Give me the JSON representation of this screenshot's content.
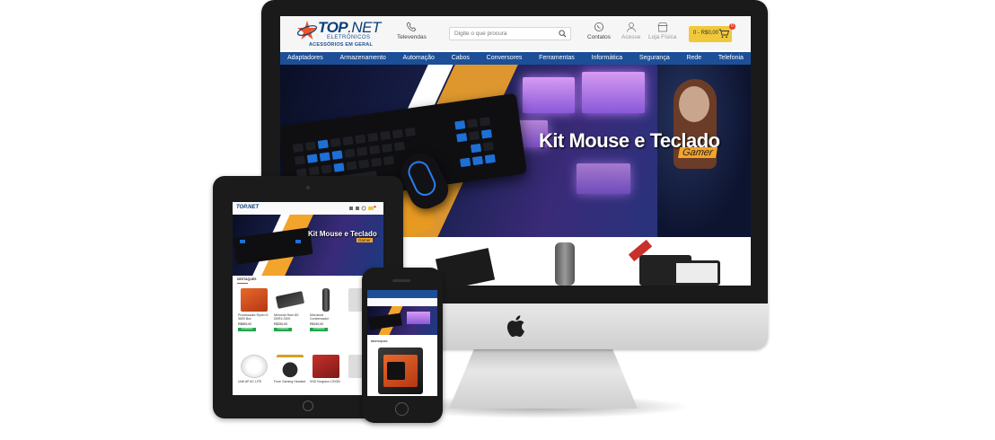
{
  "site": {
    "logo": {
      "top": "TOP",
      "net": ".NET",
      "sub": "ELETRÔNICOS",
      "tagline": "ACESSÓRIOS EM GERAL"
    },
    "header": {
      "phones_label": "Televendas",
      "search_placeholder": "Digite o que procura",
      "contact_label": "Contatos",
      "login_label": "Acesse",
      "store_label": "Loja Física",
      "cart_total": "0 - R$0,00",
      "cart_count": "0"
    },
    "nav": [
      "Adaptadores",
      "Armazenamento",
      "Automação",
      "Cabos",
      "Conversores",
      "Ferramentas",
      "Informática",
      "Segurança",
      "Rede",
      "Telefonia"
    ],
    "hero": {
      "title": "Kit Mouse e Teclado",
      "badge": "Gamer"
    }
  },
  "tablet": {
    "hero_title": "Kit Mouse e Teclado",
    "hero_badge": "Gamer",
    "section_label": "DESTAQUES",
    "products": [
      {
        "name": "Processador Ryzen 5 3600 Box",
        "price": "R$899,00",
        "button": "COMPRAR"
      },
      {
        "name": "Memória Ram 8G DDR4 3200",
        "price": "R$290,00",
        "button": "COMPRAR"
      },
      {
        "name": "Microfone Condensador",
        "price": "R$190,00",
        "button": "COMPRAR"
      },
      {
        "name": "Unifi AP AC LITE",
        "price": "",
        "button": ""
      },
      {
        "name": "Fone Gaming Headset",
        "price": "",
        "button": ""
      },
      {
        "name": "SSD Kingston 120GB",
        "price": "",
        "button": ""
      }
    ]
  },
  "phone": {
    "section_label": "DESTAQUES"
  },
  "colors": {
    "brand_blue": "#1c4f97",
    "accent_orange": "#f3a42a",
    "buy_green": "#1fa64a",
    "cart_yellow": "#f0c93b"
  }
}
